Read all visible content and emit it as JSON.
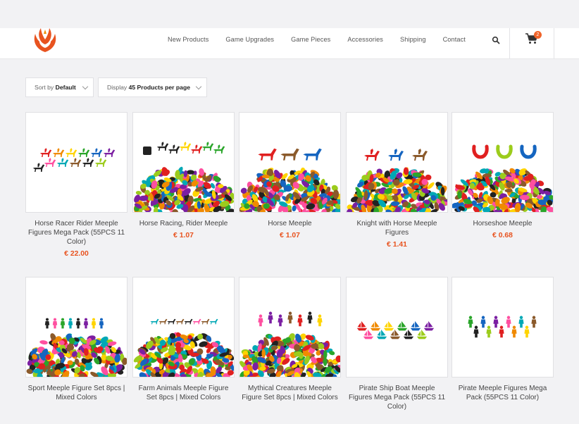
{
  "nav": {
    "items": [
      "New Products",
      "Game Upgrades",
      "Game Pieces",
      "Accessories",
      "Shipping",
      "Contact"
    ],
    "cart_count": "2"
  },
  "controls": {
    "sort_prefix": "Sort by",
    "sort_value": "Default",
    "display_prefix": "Display",
    "display_value": "45 Products per page"
  },
  "products": [
    {
      "title": "Horse Racer Rider Meeple Figures Mega Pack (55PCS 11 Color)",
      "price": "€ 22.00"
    },
    {
      "title": "Horse Racing, Rider Meeple",
      "price": "€ 1.07"
    },
    {
      "title": "Horse Meeple",
      "price": "€ 1.07"
    },
    {
      "title": "Knight with Horse Meeple Figures",
      "price": "€ 1.41"
    },
    {
      "title": "Horseshoe Meeple",
      "price": "€ 0.68"
    },
    {
      "title": "Sport Meeple Figure Set 8pcs | Mixed Colors",
      "price": ""
    },
    {
      "title": "Farm Animals Meeple Figure Set 8pcs | Mixed Colors",
      "price": ""
    },
    {
      "title": "Mythical Creatures Meeple Figure Set 8pcs | Mixed Colors",
      "price": ""
    },
    {
      "title": "Pirate Ship Boat Meeple Figures Mega Pack (55PCS 11 Color)",
      "price": ""
    },
    {
      "title": "Pirate Meeple Figures Mega Pack (55PCS 11 Color)",
      "price": ""
    }
  ],
  "colors": {
    "accent": "#e8531f",
    "pieces": [
      "#e02020",
      "#f08a00",
      "#ffd400",
      "#2aa52a",
      "#1565c0",
      "#7b1fa2",
      "#ff4fa0",
      "#00a8b5",
      "#8b5a2b",
      "#222222",
      "#9ccc1c"
    ]
  }
}
